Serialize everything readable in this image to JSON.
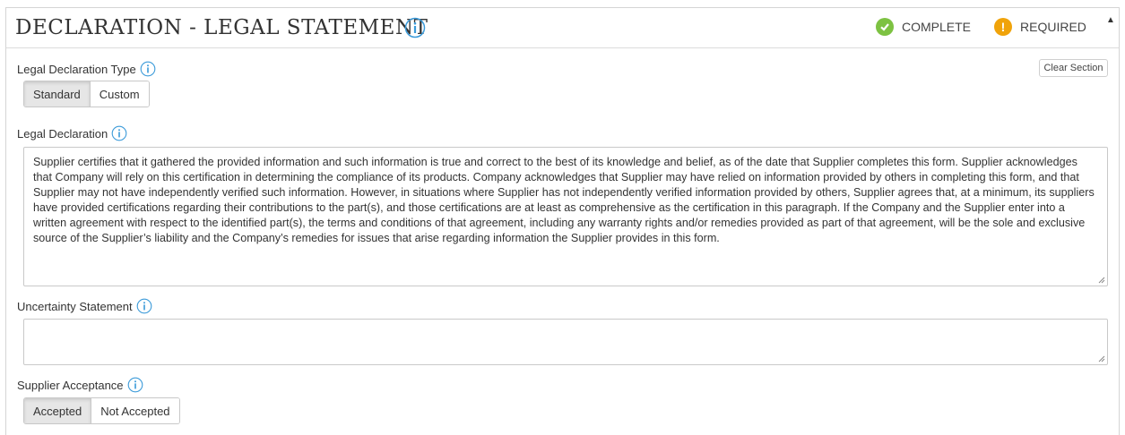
{
  "header": {
    "title": "DECLARATION - LEGAL STATEMENT",
    "complete_label": "COMPLETE",
    "required_label": "REQUIRED",
    "complete_color": "#7dc242",
    "required_color": "#f0a30a",
    "info_color": "#3a9ad9"
  },
  "legal_type": {
    "label": "Legal Declaration Type",
    "options": [
      "Standard",
      "Custom"
    ],
    "selected": "Standard"
  },
  "clear_section_label": "Clear Section",
  "legal_declaration": {
    "label": "Legal Declaration",
    "text": "Supplier certifies that it gathered the provided information and such information is true and correct to the best of its knowledge and belief, as of the date that Supplier completes this form. Supplier acknowledges that Company will rely on this certification in determining the compliance of its products. Company acknowledges that Supplier may have relied on information provided by others in completing this form, and that Supplier may not have independently verified such information. However, in situations where Supplier has not independently verified information provided by others, Supplier agrees that, at a minimum, its suppliers have provided certifications regarding their contributions to the part(s), and those certifications are at least as comprehensive as the certification in this paragraph. If the Company and the Supplier enter into a written agreement with respect to the identified part(s), the terms and conditions of that agreement, including any warranty rights and/or remedies provided as part of that agreement, will be the sole and exclusive source of the Supplier’s liability and the Company’s remedies for issues that arise regarding information the Supplier provides in this form."
  },
  "uncertainty": {
    "label": "Uncertainty Statement",
    "value": ""
  },
  "acceptance": {
    "label": "Supplier Acceptance",
    "options": [
      "Accepted",
      "Not Accepted"
    ],
    "selected": "Accepted"
  }
}
